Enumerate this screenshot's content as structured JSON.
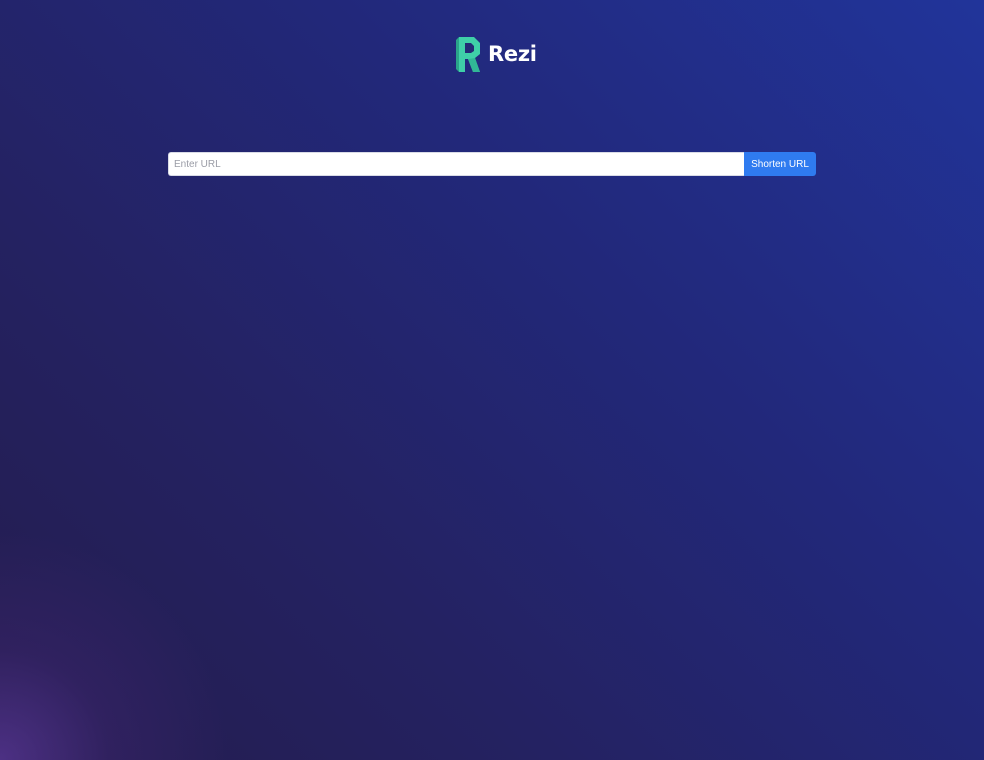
{
  "brand": {
    "name": "Rezi",
    "logo_icon": "rezi-r-logo-icon",
    "logo_color": "#3fcfa8"
  },
  "shortener": {
    "input_placeholder": "Enter URL",
    "input_value": "",
    "button_label": "Shorten URL",
    "button_color": "#2f7bf0"
  }
}
